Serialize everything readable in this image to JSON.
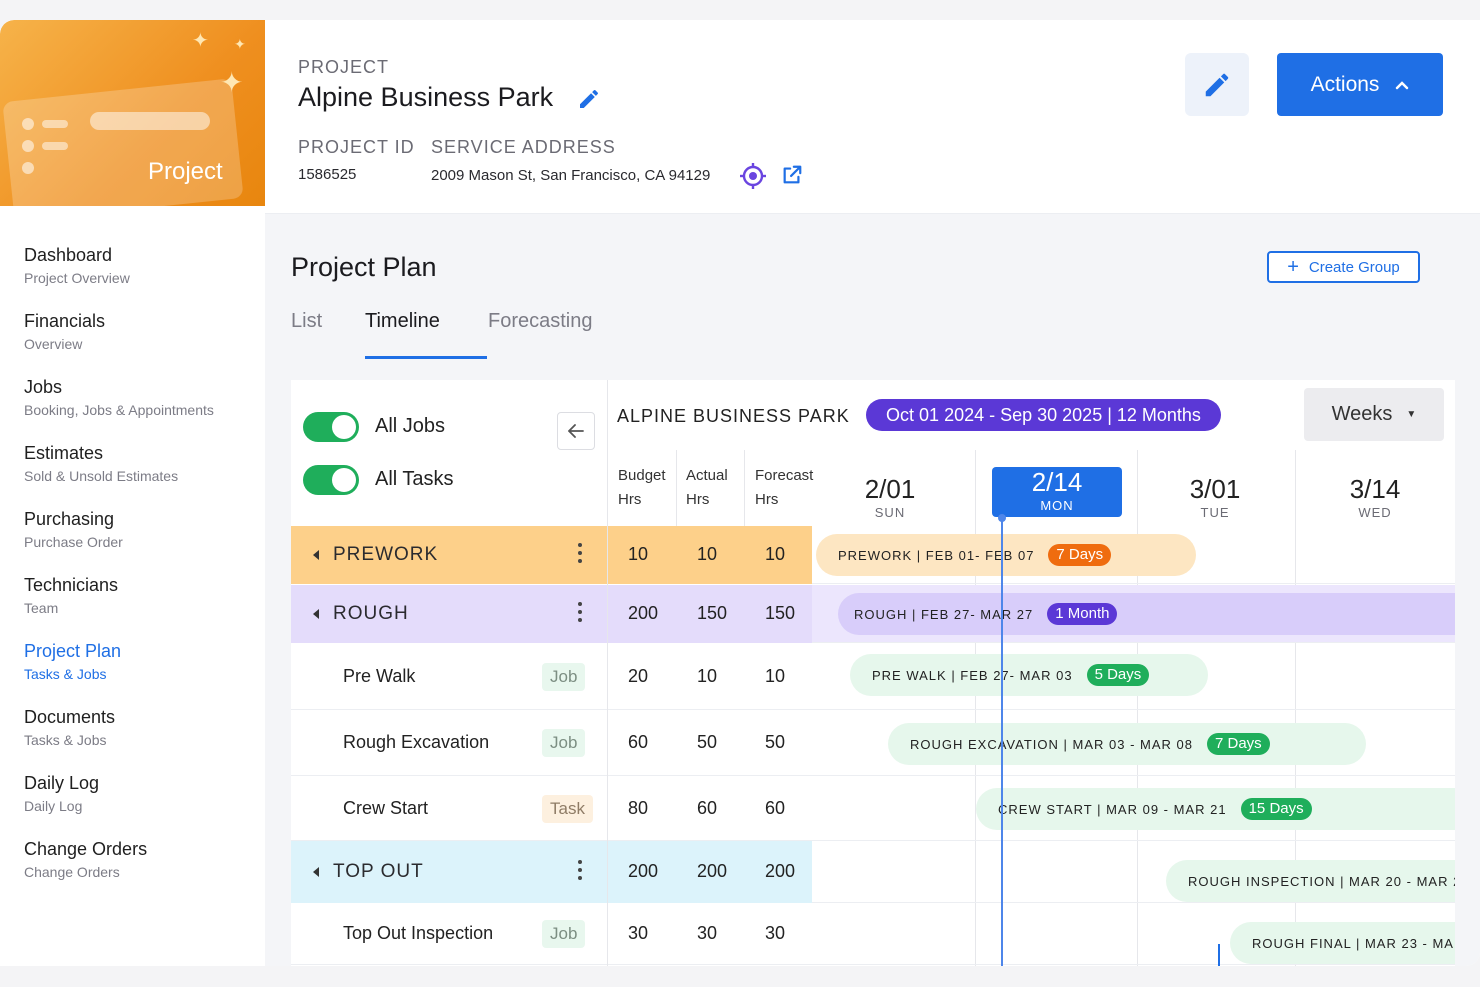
{
  "brand": {
    "label": "Project"
  },
  "sidebar": {
    "items": [
      {
        "title": "Dashboard",
        "subtitle": "Project Overview"
      },
      {
        "title": "Financials",
        "subtitle": "Overview"
      },
      {
        "title": "Jobs",
        "subtitle": "Booking, Jobs & Appointments"
      },
      {
        "title": "Estimates",
        "subtitle": "Sold & Unsold Estimates"
      },
      {
        "title": "Purchasing",
        "subtitle": "Purchase Order"
      },
      {
        "title": "Technicians",
        "subtitle": "Team"
      },
      {
        "title": "Project Plan",
        "subtitle": "Tasks & Jobs",
        "active": true
      },
      {
        "title": "Documents",
        "subtitle": "Tasks & Jobs"
      },
      {
        "title": "Daily Log",
        "subtitle": "Daily Log"
      },
      {
        "title": "Change Orders",
        "subtitle": "Change Orders"
      }
    ]
  },
  "header": {
    "caption": "PROJECT",
    "name": "Alpine Business Park",
    "id_label": "PROJECT ID",
    "id_value": "1586525",
    "address_label": "SERVICE ADDRESS",
    "address_value": "2009 Mason St, San Francisco, CA 94129",
    "actions_label": "Actions"
  },
  "plan": {
    "title": "Project Plan",
    "create_group": "Create Group",
    "tabs": [
      "List",
      "Timeline",
      "Forecasting"
    ],
    "active_tab": "Timeline",
    "toggles": [
      {
        "label": "All Jobs",
        "on": true
      },
      {
        "label": "All Tasks",
        "on": true
      }
    ],
    "columns": [
      {
        "line1": "Budget",
        "line2": "Hrs"
      },
      {
        "line1": "Actual",
        "line2": "Hrs"
      },
      {
        "line1": "Forecast",
        "line2": "Hrs"
      }
    ],
    "rows": [
      {
        "name": "PREWORK",
        "group": true,
        "budget": "10",
        "actual": "10",
        "forecast": "10"
      },
      {
        "name": "ROUGH",
        "group": true,
        "budget": "200",
        "actual": "150",
        "forecast": "150"
      },
      {
        "name": "Pre Walk",
        "type": "Job",
        "budget": "20",
        "actual": "10",
        "forecast": "10"
      },
      {
        "name": "Rough Excavation",
        "type": "Job",
        "budget": "60",
        "actual": "50",
        "forecast": "50"
      },
      {
        "name": "Crew Start",
        "type": "Task",
        "budget": "80",
        "actual": "60",
        "forecast": "60"
      },
      {
        "name": "TOP OUT",
        "group": true,
        "budget": "200",
        "actual": "200",
        "forecast": "200"
      },
      {
        "name": "Top Out Inspection",
        "type": "Job",
        "budget": "30",
        "actual": "30",
        "forecast": "30"
      }
    ]
  },
  "timeline": {
    "title": "ALPINE BUSINESS PARK",
    "range": "Oct 01 2024 - Sep 30 2025 | 12 Months",
    "scale": "Weeks",
    "dates": [
      {
        "date": "2/01",
        "day": "SUN"
      },
      {
        "date": "2/14",
        "day": "MON",
        "today": true
      },
      {
        "date": "3/01",
        "day": "TUE"
      },
      {
        "date": "3/14",
        "day": "WED"
      }
    ],
    "bars": [
      {
        "label": "PREWORK | FEB 01- FEB 07",
        "badge": "7 Days"
      },
      {
        "label": "ROUGH | FEB 27- MAR 27",
        "badge": "1 Month"
      },
      {
        "label": "PRE WALK | FEB 27- MAR 03",
        "badge": "5 Days"
      },
      {
        "label": "ROUGH EXCAVATION | MAR 03 - MAR 08",
        "badge": "7 Days"
      },
      {
        "label": "CREW START | MAR 09 - MAR 21",
        "badge": "15 Days"
      },
      {
        "label": "ROUGH INSPECTION | MAR 20 - MAR 2"
      },
      {
        "label": "ROUGH FINAL | MAR 23 - MAI"
      }
    ]
  },
  "colors": {
    "accent": "#1f6fe5",
    "prework": "#fdd08a",
    "rough": "#e4dcfb",
    "topout": "#dcf3fb",
    "badge_orange": "#ef6c0f",
    "badge_purple": "#5b38d6",
    "badge_green": "#1fae5b",
    "toggle_on": "#1fae5b"
  }
}
